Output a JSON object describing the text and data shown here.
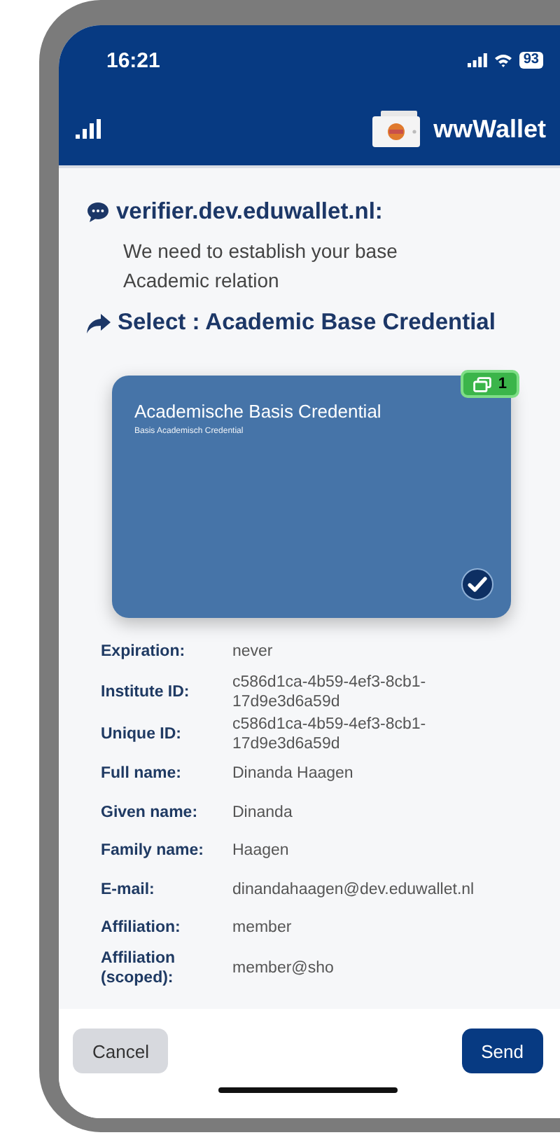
{
  "status_bar": {
    "time": "16:21",
    "battery": "93"
  },
  "header": {
    "app_name": "wwWallet"
  },
  "verifier": {
    "name": "verifier.dev.eduwallet.nl:",
    "message": "We need to establish your base Academic relation"
  },
  "select_heading": "Select : Academic Base Credential",
  "credential": {
    "title": "Academische Basis Credential",
    "subtitle": "Basis Academisch Credential",
    "count": "1",
    "selected": true
  },
  "fields": [
    {
      "label": "Expiration:",
      "value": "never"
    },
    {
      "label": "Institute ID:",
      "value": "c586d1ca-4b59-4ef3-8cb1-17d9e3d6a59d"
    },
    {
      "label": "Unique ID:",
      "value": "c586d1ca-4b59-4ef3-8cb1-17d9e3d6a59d"
    },
    {
      "label": "Full name:",
      "value": "Dinanda Haagen"
    },
    {
      "label": "Given name:",
      "value": "Dinanda"
    },
    {
      "label": "Family name:",
      "value": "Haagen"
    },
    {
      "label": "E-mail:",
      "value": "dinandahaagen@dev.eduwallet.nl"
    },
    {
      "label": "Affiliation:",
      "value": "member"
    },
    {
      "label": "Affiliation (scoped):",
      "value": "member@sho"
    }
  ],
  "buttons": [
    {
      "label": "Cancel",
      "kind": "secondary"
    },
    {
      "label": "Send",
      "kind": "primary"
    }
  ]
}
